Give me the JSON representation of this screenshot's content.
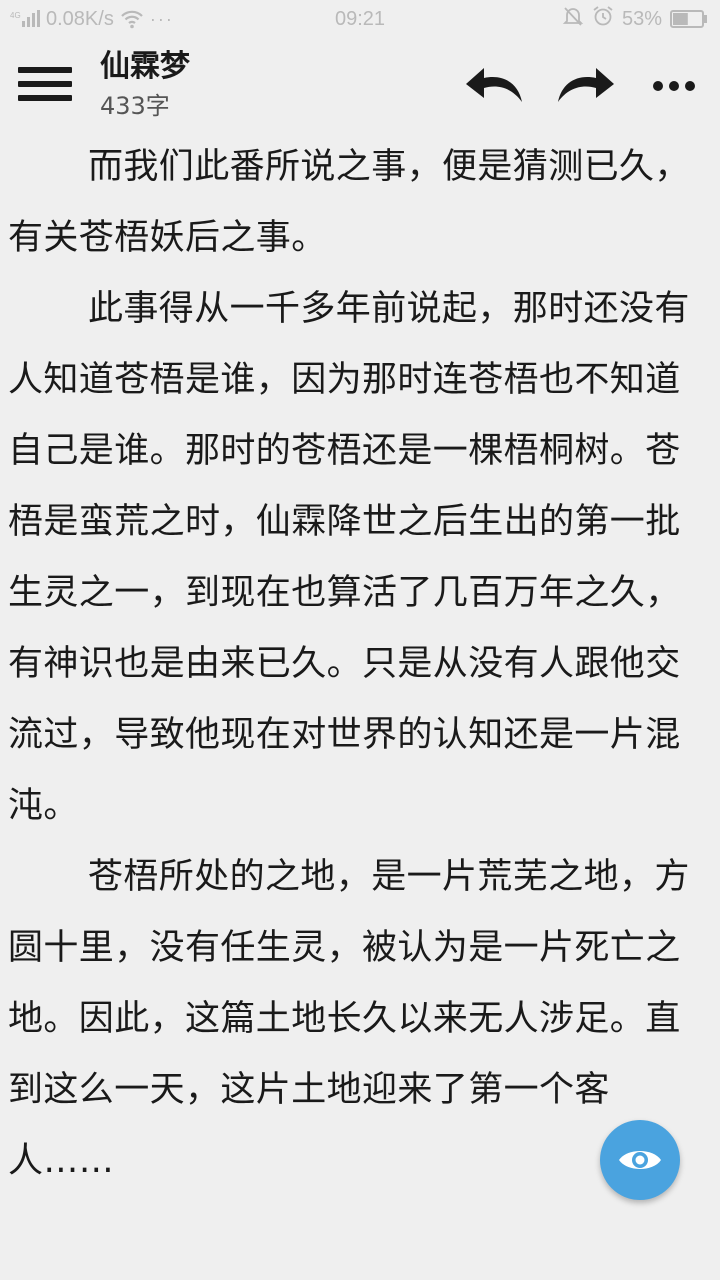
{
  "status_bar": {
    "network_speed": "0.08K/s",
    "dots": "···",
    "time": "09:21",
    "battery_percent": "53%",
    "battery_level": 0.53
  },
  "header": {
    "title": "仙霖梦",
    "word_count": "433字"
  },
  "content": {
    "paragraphs": [
      "而我们此番所说之事，便是猜测已久，有关苍梧妖后之事。",
      "此事得从一千多年前说起，那时还没有人知道苍梧是谁，因为那时连苍梧也不知道自己是谁。那时的苍梧还是一棵梧桐树。苍梧是蛮荒之时，仙霖降世之后生出的第一批生灵之一，到现在也算活了几百万年之久，有神识也是由来已久。只是从没有人跟他交流过，导致他现在对世界的认知还是一片混沌。",
      "苍梧所处的之地，是一片荒芜之地，方圆十里，没有任生灵，被认为是一片死亡之地。因此，这篇土地长久以来无人涉足。直到这么一天，这片土地迎来了第一个客人……"
    ]
  },
  "icons": {
    "menu": "menu-icon",
    "undo": "undo-icon",
    "redo": "redo-icon",
    "more": "more-icon",
    "eye": "eye-icon"
  },
  "colors": {
    "background": "#efefef",
    "fab": "#4aa3df",
    "text": "#1a1a1a",
    "status_text": "#b9b9b9"
  }
}
